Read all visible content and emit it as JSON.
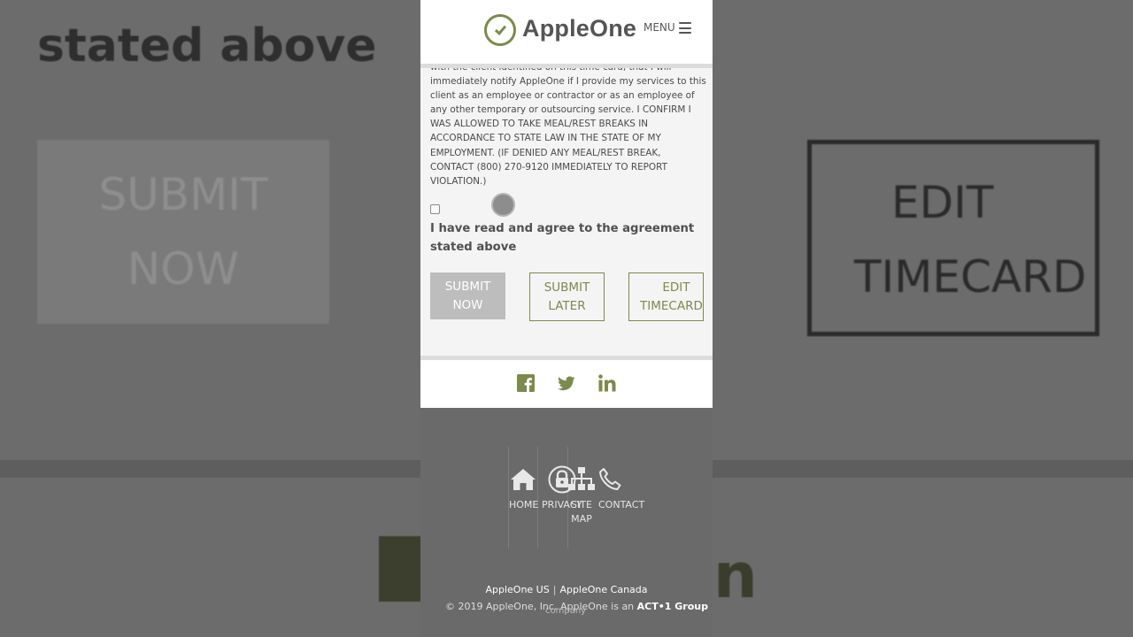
{
  "background": {
    "stated_text": "stated above",
    "submit_line1": "SUBMIT",
    "submit_line2": "NOW",
    "edit_line1": "EDIT",
    "edit_line2": "TIMECARD",
    "linkedin_letter": "n"
  },
  "header": {
    "brand": "AppleOne",
    "menu_label": "MENU"
  },
  "agreement": {
    "text": "with the client identified on this time card, that I will immediately notify AppleOne if I provide my services to this client as an employee or contractor or as an employee of any other temporary or outsourcing service. I CONFIRM I WAS ALLOWED TO TAKE MEAL/REST BREAKS IN ACCORDANCE TO STATE LAW IN THE STATE OF MY EMPLOYMENT. (IF DENIED ANY MEAL/REST BREAK, CONTACT (800) 270-9120 IMMEDIATELY TO REPORT VIOLATION.)",
    "agree_label": "I have read and agree to the agreement stated above"
  },
  "buttons": {
    "submit_now_1": "SUBMIT",
    "submit_now_2": "NOW",
    "submit_later_1": "SUBMIT",
    "submit_later_2": "LATER",
    "edit_1": "EDIT",
    "edit_2": "TIMECARD"
  },
  "social": {
    "icons": [
      "facebook-icon",
      "twitter-icon",
      "linkedin-icon"
    ]
  },
  "footer": {
    "home": "HOME",
    "privacy": "PRIVACY",
    "sitemap_1": "SITE",
    "sitemap_2": "MAP",
    "contact": "CONTACT",
    "region_us": "AppleOne US",
    "region_separator": "|",
    "region_canada": "AppleOne Canada",
    "copyright": "© 2019 AppleOne, Inc. AppleOne is an",
    "act_group": "ACT•1 Group",
    "company": "company"
  },
  "colors": {
    "accent": "#7c8a4d",
    "text": "#4a4a4a",
    "disabled_button": "#bdbdbd",
    "footer_bg": "#6a6a6a"
  }
}
